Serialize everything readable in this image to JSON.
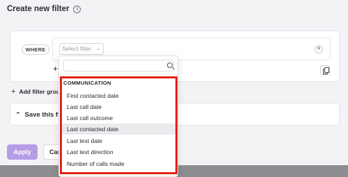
{
  "dialog": {
    "title": "Create new filter",
    "info_icon": "info-icon"
  },
  "filter_row": {
    "where_label": "WHERE",
    "select_placeholder": "Select filter",
    "select_icon": "chevron-down-icon",
    "remove_icon": "close-icon",
    "add_icon": "plus-icon",
    "duplicate_icon": "copy-icon"
  },
  "add_group_label": "Add filter group",
  "save_section": {
    "label": "Save this filter",
    "icon": "chevron-up-icon"
  },
  "actions": {
    "apply": "Apply",
    "cancel": "Cancel"
  },
  "colors": {
    "apply_bg": "#b69ce6",
    "highlight_border": "#e62117",
    "hover_row": "#ebebee"
  },
  "dropdown": {
    "search_placeholder": "",
    "search_icon": "search-icon",
    "group_label": "COMMUNICATION",
    "options": [
      "First contacted date",
      "Last call date",
      "Last call outcome",
      "Last contacted date",
      "Last text date",
      "Last text direction",
      "Number of calls made"
    ],
    "hovered_index": 3
  }
}
